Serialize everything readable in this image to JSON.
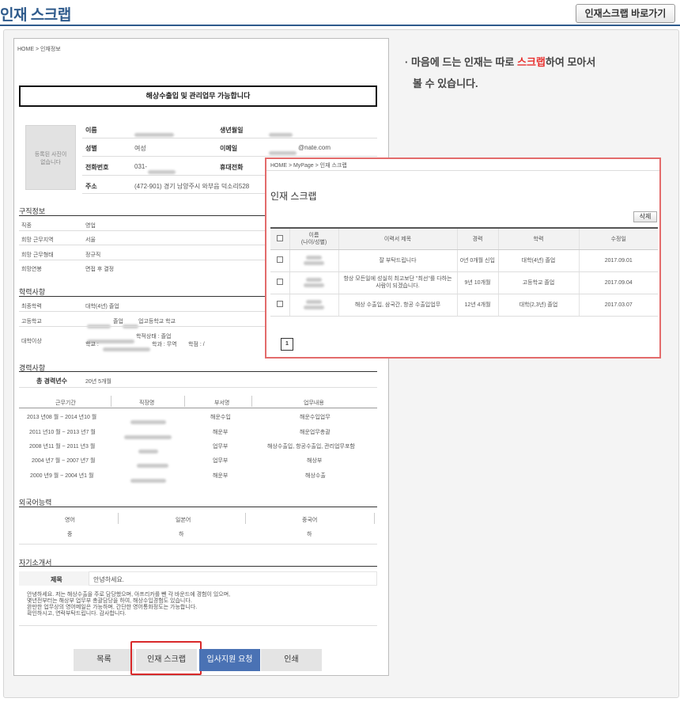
{
  "page": {
    "title": "인재 스크랩",
    "goto_button": "인재스크랩 바로가기"
  },
  "note": {
    "line1_pre": "· 마음에 드는 인재는 따로 ",
    "line1_highlight": "스크랩",
    "line1_post": "하여 모아서",
    "line2": "볼 수 있습니다."
  },
  "resume": {
    "breadcrumb": "HOME > 인재정보",
    "headline": "해상수출입 및 관리업무 가능합니다",
    "photo_text_1": "등록된 사진이",
    "photo_text_2": "없습니다",
    "profile": {
      "name_label": "이름",
      "birth_label": "생년월일",
      "gender_label": "성별",
      "gender": "여성",
      "email_label": "이메일",
      "email": "@nate.com",
      "phone_label": "전화번호",
      "phone": "031-",
      "mobile_label": "휴대전화",
      "address_label": "주소",
      "address": "(472-901) 경기 남양주시 와부읍 덕소리528"
    },
    "job": {
      "section": "구직정보",
      "rows": [
        {
          "label": "직종",
          "value": "영업"
        },
        {
          "label": "희망 근무지역",
          "value": "서울"
        },
        {
          "label": "희망 근무형태",
          "value": "정규직"
        },
        {
          "label": "희망연봉",
          "value": "면접 후 결정"
        }
      ]
    },
    "education": {
      "section": "학력사항",
      "final_label": "최종학력",
      "final_value": "대학(4년) 졸업",
      "high_label": "고등학교",
      "high_mid": "졸업",
      "high_value": "업고등학교 학교",
      "univ_label": "대학이상",
      "univ_status": "학적상태 : 졸업",
      "univ_line2_a": "학교 :",
      "univ_line2_b": "학과 : 무역",
      "univ_line2_c": "학점 : /"
    },
    "career": {
      "section": "경력사항",
      "total_label": "총 경력년수",
      "total_value": "20년 5개월",
      "headers": [
        "근무기간",
        "직장명",
        "부서명",
        "업무내용"
      ],
      "rows": [
        {
          "period": "2013 년08 월 ~ 2014 년10 월",
          "dept": "해운수입",
          "task": "해운수입업무"
        },
        {
          "period": "2011 년10 월 ~ 2013 년7 월",
          "dept": "해운부",
          "task": "해운업무총괄"
        },
        {
          "period": "2008 년11 월 ~ 2011 년3 월",
          "dept": "업무부",
          "task": "해상수출입, 항공수출입, 관리업무포함"
        },
        {
          "period": "2004 년7 월 ~ 2007 년7 월",
          "dept": "업무부",
          "task": "해상부"
        },
        {
          "period": "2000 년9 월 ~ 2004 년1 월",
          "dept": "해운부",
          "task": "해상수출"
        }
      ]
    },
    "language": {
      "section": "외국어능력",
      "headers": [
        "영어",
        "일본어",
        "중국어"
      ],
      "values": [
        "중",
        "하",
        "하"
      ]
    },
    "intro": {
      "section": "자기소개서",
      "subject_label": "제목",
      "subject_value": "안녕하세요.",
      "lines": [
        "안녕하세요. 저는 해상수출을 주로 담당했으며, 아프리카를 뺀 각 바운드에 경험이 있으며,",
        "몇년전부터는 해상부 업무부 총괄담당을 하여, 해상수입경험도 있습니다.",
        "완만한 업무상의 영어메일은 가능하며, 간단한 영어통화정도는 가능합니다.",
        "확인하시고, 연락부탁드립니다. 감사합니다."
      ]
    },
    "buttons": {
      "list": "목록",
      "scrap": "인재 스크랩",
      "request": "입사지원 요청",
      "print": "인쇄"
    }
  },
  "popup": {
    "breadcrumb": "HOME > MyPage > 인재 스크랩",
    "title": "인재 스크랩",
    "delete_button": "삭제",
    "headers": [
      "",
      "이름\n(나이/성별)",
      "이력서 제목",
      "경력",
      "학력",
      "수정일"
    ],
    "rows": [
      {
        "title": "잘 부탁드립니다",
        "career": "0년 0개월 신입",
        "edu": "대학(4년) 졸업",
        "date": "2017.09.01"
      },
      {
        "title": "항상 모든일에 성실히 최고보단 \"최선\"를 다하는 사람이 되겠습니다.",
        "career": "9년 10개월",
        "edu": "고등학교 졸업",
        "date": "2017.09.04"
      },
      {
        "title": "해상 수출입, 삼국간, 항공 수출입업무",
        "career": "12년 4개월",
        "edu": "대학(2,3년) 졸업",
        "date": "2017.03.07"
      }
    ],
    "page_number": "1"
  },
  "colors": {
    "accent_blue": "#2f5b8c",
    "highlight_red": "#e8312f",
    "request_blue": "#4a72b4"
  }
}
